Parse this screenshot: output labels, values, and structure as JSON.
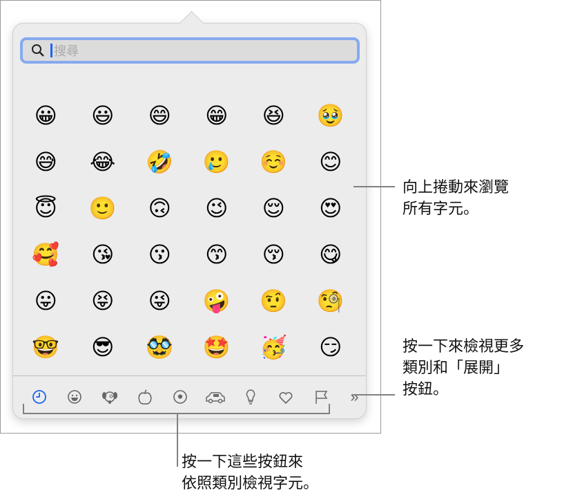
{
  "search": {
    "placeholder": "搜尋"
  },
  "emojis": [
    "😀",
    "😃",
    "😄",
    "😁",
    "😆",
    "🥹",
    "😅",
    "😂",
    "🤣",
    "🥲",
    "☺️",
    "😊",
    "😇",
    "🙂",
    "🙃",
    "😉",
    "😌",
    "😍",
    "🥰",
    "😘",
    "😗",
    "😙",
    "😚",
    "😋",
    "😛",
    "😝",
    "😜",
    "🤪",
    "🤨",
    "🧐",
    "🤓",
    "😎",
    "🥸",
    "🤩",
    "🥳",
    "😏"
  ],
  "categories": [
    "recent",
    "smileys",
    "animals",
    "food",
    "activities",
    "travel",
    "objects",
    "symbols",
    "flags"
  ],
  "more_label": "»",
  "callouts": {
    "scroll": [
      "向上捲動來瀏覽",
      "所有字元。"
    ],
    "expand": [
      "按一下來檢視更多",
      "類別和「展開」",
      "按鈕。"
    ],
    "categories": [
      "按一下這些按鈕來",
      "依照類別檢視字元。"
    ]
  },
  "colors": {
    "accent": "#1b63f0",
    "focus_ring": "#86aaf0"
  }
}
